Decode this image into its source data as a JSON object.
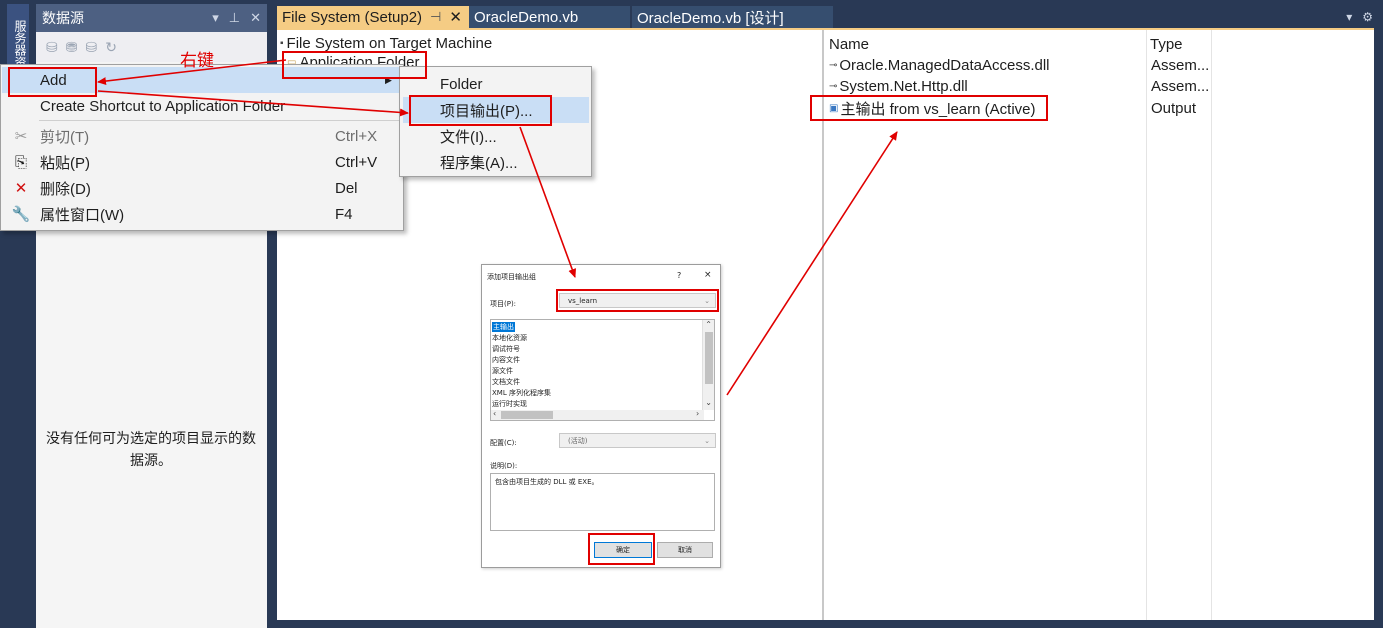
{
  "server_explorer_tab": "服务器资",
  "datasources": {
    "title": "数据源",
    "empty_message": "没有任何可为选定的项目显示的数据源。"
  },
  "tabs": [
    {
      "label": "File System (Setup2)",
      "active": true
    },
    {
      "label": "OracleDemo.vb",
      "active": false
    },
    {
      "label": "OracleDemo.vb [设计]",
      "active": false
    }
  ],
  "filesystem": {
    "root": "File System on Target Machine",
    "app_folder": "Application Folder",
    "columns": {
      "name": "Name",
      "type": "Type"
    },
    "items": [
      {
        "name": "Oracle.ManagedDataAccess.dll",
        "type": "Assem..."
      },
      {
        "name": "System.Net.Http.dll",
        "type": "Assem..."
      },
      {
        "name": "主输出 from vs_learn (Active)",
        "type": "Output"
      }
    ]
  },
  "context_menu": {
    "add": "Add",
    "create_shortcut": "Create Shortcut to Application Folder",
    "cut": "剪切(T)",
    "cut_shortcut": "Ctrl+X",
    "paste": "粘贴(P)",
    "paste_shortcut": "Ctrl+V",
    "delete": "删除(D)",
    "delete_shortcut": "Del",
    "properties": "属性窗口(W)",
    "properties_shortcut": "F4"
  },
  "add_submenu": {
    "folder": "Folder",
    "project_output": "项目输出(P)...",
    "file": "文件(I)...",
    "assembly": "程序集(A)..."
  },
  "annotation": {
    "right_click": "右键"
  },
  "dialog": {
    "title": "添加项目输出组",
    "help": "?",
    "close": "×",
    "project_label": "项目(P):",
    "project_value": "vs_learn",
    "list_items": [
      "主输出",
      "本地化资源",
      "调试符号",
      "内容文件",
      "源文件",
      "文档文件",
      "XML 序列化程序集",
      "运行时实现"
    ],
    "config_label": "配置(C):",
    "config_value": "(活动)",
    "desc_label": "说明(D):",
    "desc_value": "包含由项目生成的 DLL 或 EXE。",
    "ok": "确定",
    "cancel": "取消"
  },
  "colors": {
    "accent_tab": "#f5cc84",
    "annotation_red": "#e00000",
    "menu_highlight": "#c9def5",
    "frame": "#293955"
  }
}
